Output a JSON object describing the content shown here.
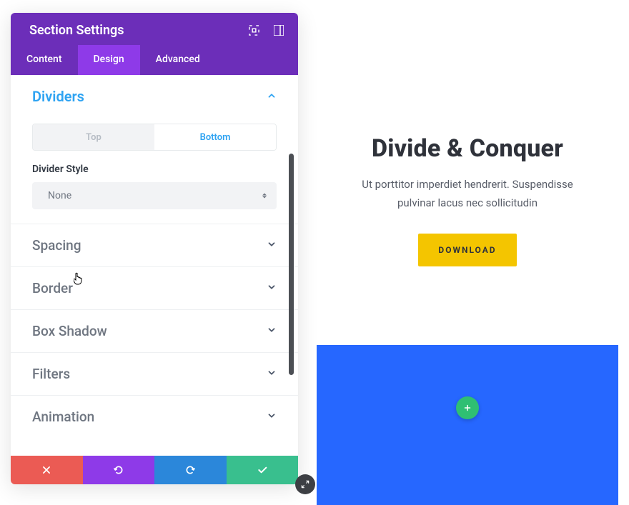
{
  "panel": {
    "title": "Section Settings",
    "tabs": {
      "content": "Content",
      "design": "Design",
      "advanced": "Advanced"
    },
    "dividers": {
      "title": "Dividers",
      "top_label": "Top",
      "bottom_label": "Bottom",
      "style_label": "Divider Style",
      "style_value": "None"
    },
    "sections": {
      "spacing": "Spacing",
      "border": "Border",
      "box_shadow": "Box Shadow",
      "filters": "Filters",
      "animation": "Animation"
    }
  },
  "preview": {
    "heading": "Divide & Conquer",
    "body": "Ut porttitor imperdiet hendrerit. Suspendisse pulvinar lacus nec sollicitudin",
    "cta": "DOWNLOAD"
  },
  "colors": {
    "purple_header": "#6c2eb9",
    "purple_active": "#8e3ae8",
    "accent_blue": "#2ea3f2",
    "danger": "#eb5b54",
    "info": "#2b87da",
    "success": "#39bf8e",
    "section_blue": "#2667ff",
    "cta_yellow": "#f4c500",
    "add_green": "#2fbf73"
  }
}
